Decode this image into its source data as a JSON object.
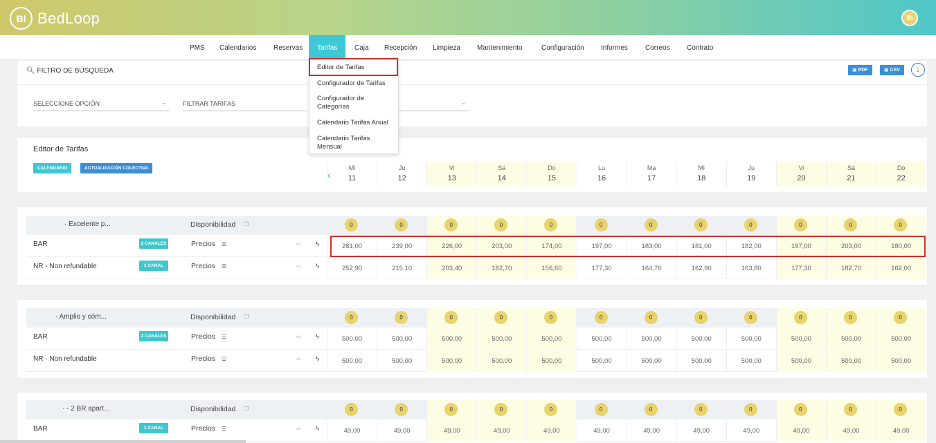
{
  "app": {
    "logo_mark": "Bl",
    "name": "BedLoop",
    "avatar": "Bl"
  },
  "nav": {
    "items": [
      "PMS",
      "Calendarios",
      "Reservas",
      "Tarifas",
      "Caja",
      "Recepción",
      "Limpieza",
      "Mantenimiento",
      "Configuración",
      "Informes",
      "Correos",
      "Contrato"
    ],
    "active": "Tarifas"
  },
  "dropdown": {
    "items": [
      "Editor de Tarifas",
      "Configurador de Tarifas",
      "Configurador de Categorías",
      "Calendario Tarifas Anual",
      "Calendario Tarifas Mensual"
    ],
    "highlighted": "Editor de Tarifas"
  },
  "filter": {
    "title": "FILTRO DE BÚSQUEDA",
    "select_option": "SELECCIONE OPCIÓN",
    "filter_rates": "FILTRAR TARIFAS",
    "pdf_label": "PDF",
    "csv_label": "CSV"
  },
  "editor": {
    "title": "Editor de Tarifas",
    "calendar_btn": "CALENDARIO",
    "bulk_btn": "ACTUALIZACIÓN COLECTIVA",
    "days": [
      {
        "name": "Mi",
        "num": "11"
      },
      {
        "name": "Ju",
        "num": "12"
      },
      {
        "name": "Vi",
        "num": "13"
      },
      {
        "name": "Sá",
        "num": "14"
      },
      {
        "name": "Do",
        "num": "15"
      },
      {
        "name": "Lu",
        "num": "16"
      },
      {
        "name": "Ma",
        "num": "17"
      },
      {
        "name": "Mi",
        "num": "18"
      },
      {
        "name": "Ju",
        "num": "19"
      },
      {
        "name": "Vi",
        "num": "20"
      },
      {
        "name": "Sá",
        "num": "21"
      },
      {
        "name": "Do",
        "num": "22"
      }
    ]
  },
  "labels": {
    "availability": "Disponibilidad",
    "prices": "Precios"
  },
  "rooms": [
    {
      "name": "· Excelente p...",
      "availability": [
        "0",
        "0",
        "0",
        "0",
        "0",
        "0",
        "0",
        "0",
        "0",
        "0",
        "0",
        "0"
      ],
      "rates": [
        {
          "name": "BAR",
          "channels": "2 CANALES",
          "prices": [
            "281,00",
            "239,00",
            "226,00",
            "203,00",
            "174,00",
            "197,00",
            "183,00",
            "181,00",
            "182,00",
            "197,00",
            "203,00",
            "180,00"
          ]
        },
        {
          "name": "NR - Non refundable",
          "channels": "1 CANAL",
          "prices": [
            "252,90",
            "215,10",
            "203,40",
            "182,70",
            "156,60",
            "177,30",
            "164,70",
            "162,90",
            "163,80",
            "177,30",
            "182,70",
            "162,00"
          ]
        }
      ]
    },
    {
      "name": "· Amplio y cóm...",
      "availability": [
        "0",
        "0",
        "0",
        "0",
        "0",
        "0",
        "0",
        "0",
        "0",
        "0",
        "0",
        "0"
      ],
      "rates": [
        {
          "name": "BAR",
          "channels": "2 CANALES",
          "prices": [
            "500,00",
            "500,00",
            "500,00",
            "500,00",
            "500,00",
            "500,00",
            "500,00",
            "500,00",
            "500,00",
            "500,00",
            "500,00",
            "500,00"
          ]
        },
        {
          "name": "NR - Non refundable",
          "channels": "",
          "prices": [
            "500,00",
            "500,00",
            "500,00",
            "500,00",
            "500,00",
            "500,00",
            "500,00",
            "500,00",
            "500,00",
            "500,00",
            "500,00",
            "500,00"
          ]
        }
      ]
    },
    {
      "name": "· - 2 BR apart...",
      "availability": [
        "0",
        "0",
        "0",
        "0",
        "0",
        "0",
        "0",
        "0",
        "0",
        "0",
        "0",
        "0"
      ],
      "rates": [
        {
          "name": "BAR",
          "channels": "1 CANAL",
          "prices": [
            "49,00",
            "49,00",
            "49,00",
            "49,00",
            "49,00",
            "49,00",
            "49,00",
            "49,00",
            "49,00",
            "49,00",
            "49,00",
            "49,00"
          ]
        }
      ]
    }
  ],
  "colors": {
    "accent": "#3ec8d6",
    "button_blue": "#3a8fd6",
    "weekend": "#fdfde4",
    "highlight_red": "#d42a2a",
    "avail_badge": "#e8d36c"
  }
}
